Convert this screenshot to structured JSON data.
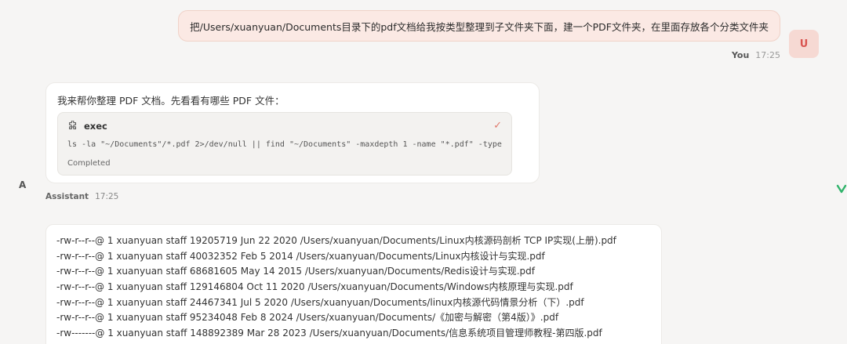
{
  "user_message": {
    "text": "把/Users/xuanyuan/Documents目录下的pdf文档给我按类型整理到子文件夹下面，建一个PDF文件夹，在里面存放各个分类文件夹",
    "sender": "You",
    "time": "17:25",
    "avatar_letter": "U"
  },
  "assistant_message": {
    "text": "我来帮你整理 PDF 文档。先看看有哪些 PDF 文件：",
    "tool": {
      "name": "exec",
      "icon": "puzzle-icon",
      "command": "ls -la \"~/Documents\"/*.pdf 2>/dev/null || find \"~/Documents\" -maxdepth 1 -name \"*.pdf\" -type f",
      "status": "Completed",
      "status_icon": "check-icon"
    },
    "sender": "Assistant",
    "time": "17:25",
    "avatar_letter": "A"
  },
  "file_listing": [
    "-rw-r--r--@ 1 xuanyuan staff 19205719 Jun 22 2020 /Users/xuanyuan/Documents/Linux内核源码剖析 TCP IP实现(上册).pdf",
    "-rw-r--r--@ 1 xuanyuan staff 40032352 Feb 5 2014 /Users/xuanyuan/Documents/Linux内核设计与实现.pdf",
    "-rw-r--r--@ 1 xuanyuan staff 68681605 May 14 2015 /Users/xuanyuan/Documents/Redis设计与实现.pdf",
    "-rw-r--r--@ 1 xuanyuan staff 129146804 Oct 11 2020 /Users/xuanyuan/Documents/Windows内核原理与实现.pdf",
    "-rw-r--r--@ 1 xuanyuan staff 24467341 Jul 5 2020 /Users/xuanyuan/Documents/linux内核源代码情景分析（下）.pdf",
    "-rw-r--r--@ 1 xuanyuan staff 95234048 Feb 8 2024 /Users/xuanyuan/Documents/《加密与解密（第4版）》.pdf",
    "-rw-------@ 1 xuanyuan staff 148892389 Mar 28 2023 /Users/xuanyuan/Documents/信息系统项目管理师教程-第四版.pdf"
  ],
  "colors": {
    "background": "#f6f5f4",
    "user_bubble": "#fbe9e4",
    "user_avatar": "#f6d9d3",
    "accent": "#d9534f",
    "check": "#e07a6d",
    "edge_icon": "#2fb36a"
  },
  "edge_icon": "leaf-icon"
}
